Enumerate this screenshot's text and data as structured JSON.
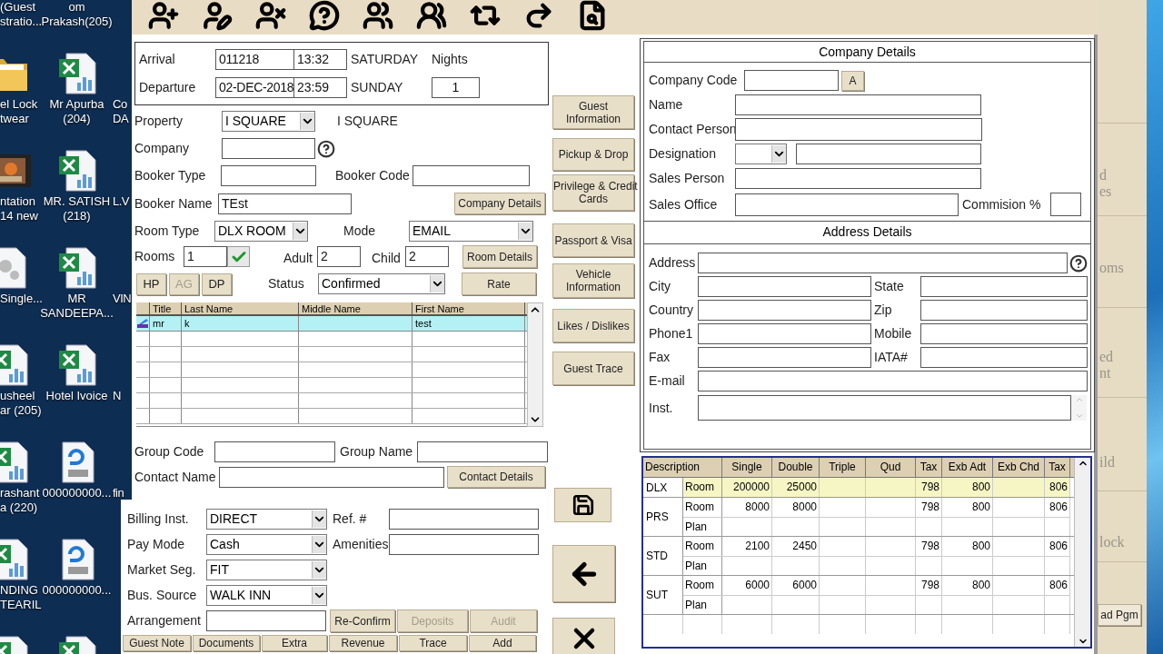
{
  "desktop_rows": [
    [
      {
        "label_lines": [
          "(Guest",
          "stratio..."
        ]
      },
      {
        "label_lines": [
          "om",
          "Prakash(205)"
        ]
      },
      null
    ],
    [
      {
        "kind": "folder",
        "label_lines": [
          "el Lock",
          "twear"
        ]
      },
      {
        "kind": "excel",
        "label_lines": [
          "Mr Apurba",
          "(204)"
        ]
      },
      {
        "label_lines": [
          "Co",
          "DA"
        ]
      }
    ],
    [
      {
        "kind": "video",
        "label_lines": [
          "ntation",
          "14 new"
        ]
      },
      {
        "kind": "excel",
        "label_lines": [
          "MR. SATISH",
          "(218)"
        ]
      },
      {
        "label_lines": [
          "L.V"
        ]
      }
    ],
    [
      {
        "kind": "gear",
        "label_lines": [
          "Single..."
        ]
      },
      {
        "kind": "excel",
        "label_lines": [
          "MR",
          "SANDEEPA..."
        ]
      },
      {
        "label_lines": [
          "VIN"
        ]
      }
    ],
    [
      {
        "kind": "excel",
        "label_lines": [
          "usheel",
          "ar (205)"
        ]
      },
      {
        "kind": "excel",
        "label_lines": [
          "Hotel Ivoice"
        ]
      },
      {
        "label_lines": [
          "N"
        ]
      }
    ],
    [
      {
        "kind": "excel",
        "label_lines": [
          "rashant",
          "a (220)"
        ]
      },
      {
        "kind": "pdf",
        "label_lines": [
          "000000000..."
        ]
      },
      {
        "label_lines": [
          "fin"
        ]
      }
    ],
    [
      {
        "kind": "excel",
        "label_lines": [
          "NDING",
          "TEARIL"
        ]
      },
      {
        "kind": "pdf",
        "label_lines": [
          "000000000..."
        ]
      },
      null
    ],
    [
      {
        "kind": "excel"
      },
      {
        "kind": "excel"
      },
      null
    ]
  ],
  "stay": {
    "arrival": {
      "label": "Arrival",
      "date": "011218",
      "time": "13:32",
      "day": "SATURDAY"
    },
    "departure": {
      "label": "Departure",
      "date": "02-DEC-2018",
      "time": "23:59",
      "day": "SUNDAY"
    },
    "nights": {
      "label": "Nights",
      "value": "1"
    }
  },
  "booking": {
    "property": {
      "label": "Property",
      "value": "I SQUARE",
      "name": "I SQUARE"
    },
    "company": {
      "label": "Company"
    },
    "booker_type": {
      "label": "Booker Type"
    },
    "booker_code": {
      "label": "Booker Code"
    },
    "booker_name": {
      "label": "Booker Name",
      "value": "TEst"
    },
    "company_details_button": "Company Details",
    "room_type": {
      "label": "Room Type",
      "value": "DLX ROOM"
    },
    "mode": {
      "label": "Mode",
      "value": "EMAIL"
    },
    "rooms": {
      "label": "Rooms",
      "value": "1"
    },
    "adult": {
      "label": "Adult",
      "value": "2"
    },
    "child": {
      "label": "Child",
      "value": "2"
    },
    "room_details_button": "Room Details",
    "plan_buttons": [
      {
        "label": "HP",
        "disabled": false
      },
      {
        "label": "AG",
        "disabled": true
      },
      {
        "label": "DP",
        "disabled": false
      }
    ],
    "status": {
      "label": "Status",
      "value": "Confirmed"
    },
    "rate_button": "Rate"
  },
  "guests": {
    "columns": [
      "Title",
      "Last Name",
      "Middle Name",
      "First Name"
    ],
    "rows": [
      {
        "title": "mr",
        "last_name": "k",
        "first_name": "test",
        "selected": true
      }
    ]
  },
  "group": {
    "group_code": {
      "label": "Group Code"
    },
    "group_name": {
      "label": "Group Name"
    },
    "contact_name": {
      "label": "Contact Name"
    },
    "contact_details_button": "Contact Details"
  },
  "side_buttons": [
    [
      "Guest",
      "Information"
    ],
    [
      "Pickup & Drop"
    ],
    [
      "Privilege & Credit",
      "Cards"
    ],
    [
      "Passport & Visa"
    ],
    [
      "Vehicle",
      "Information"
    ],
    [
      "Likes / Dislikes"
    ],
    [
      "Guest Trace"
    ]
  ],
  "company_details": {
    "title": "Company Details",
    "company_code": "Company Code",
    "lookup_button": "A",
    "name": "Name",
    "contact_person": "Contact Person",
    "designation": "Designation",
    "sales_person": "Sales Person",
    "sales_office": "Sales Office",
    "commission": "Commision %"
  },
  "address_details": {
    "title": "Address Details",
    "address": "Address",
    "city": "City",
    "state": "State",
    "country": "Country",
    "zip": "Zip",
    "phone1": "Phone1",
    "mobile": "Mobile",
    "fax": "Fax",
    "iata": "IATA#",
    "email": "E-mail",
    "inst": "Inst."
  },
  "rates": {
    "columns": [
      "Description",
      "Single",
      "Double",
      "Triple",
      "Qud",
      "Tax",
      "Exb Adt",
      "Exb Chd",
      "Tax"
    ],
    "rows": [
      {
        "code": "DLX",
        "lines": [
          {
            "label": "Room",
            "single": "200000",
            "double": "25000",
            "tax": "798",
            "exb_adt": "800",
            "tax_2": "806",
            "selected": true
          }
        ]
      },
      {
        "code": "PRS",
        "lines": [
          {
            "label": "Room",
            "single": "8000",
            "double": "8000",
            "tax": "798",
            "exb_adt": "800",
            "tax_2": "806",
            "selected": false
          },
          {
            "label": "Plan",
            "selected": false
          }
        ]
      },
      {
        "code": "STD",
        "lines": [
          {
            "label": "Room",
            "single": "2100",
            "double": "2450",
            "tax": "798",
            "exb_adt": "800",
            "tax_2": "806",
            "selected": false
          },
          {
            "label": "Plan",
            "selected": false
          }
        ]
      },
      {
        "code": "SUT",
        "lines": [
          {
            "label": "Room",
            "single": "6000",
            "double": "6000",
            "tax": "798",
            "exb_adt": "800",
            "tax_2": "806",
            "selected": false
          },
          {
            "label": "Plan",
            "selected": false
          }
        ]
      }
    ]
  },
  "billing": {
    "billing_inst": {
      "label": "Billing Inst.",
      "value": "DIRECT"
    },
    "ref": {
      "label": "Ref. #"
    },
    "pay_mode": {
      "label": "Pay Mode",
      "value": "Cash"
    },
    "amenities": {
      "label": "Amenities"
    },
    "market_seg": {
      "label": "Market Seg.",
      "value": "FIT"
    },
    "bus_source": {
      "label": "Bus. Source",
      "value": "WALK INN"
    },
    "arrangement": {
      "label": "Arrangement"
    },
    "buttons": [
      {
        "label": "Re-Confirm",
        "disabled": false
      },
      {
        "label": "Deposits",
        "disabled": true
      },
      {
        "label": "Audit",
        "disabled": true
      }
    ],
    "bottom_buttons": [
      "Guest Note",
      "Documents",
      "Extra",
      "Revenue",
      "Trace",
      "Add"
    ]
  },
  "back_window": {
    "texts": [
      [
        "d",
        "es"
      ],
      [
        "oms"
      ],
      [
        "ed",
        "nt"
      ],
      [
        "ild"
      ],
      [
        "lock"
      ]
    ],
    "button": "ad Pgm"
  }
}
